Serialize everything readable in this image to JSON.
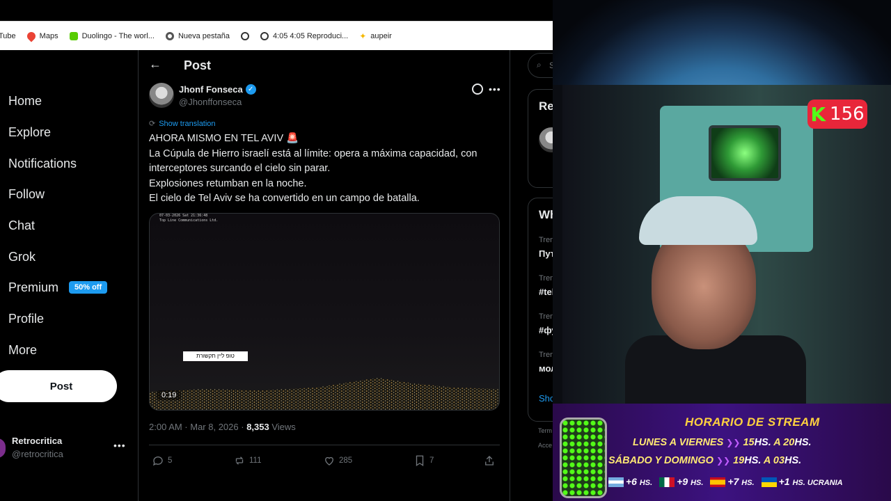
{
  "bookmarks": [
    {
      "label": "Tube",
      "icon": "youtube-icon",
      "color": "#ff0000"
    },
    {
      "label": "Maps",
      "icon": "maps-pin-icon",
      "color": "#34a853"
    },
    {
      "label": "Duolingo - The worl...",
      "icon": "duolingo-icon",
      "color": "#58cc02"
    },
    {
      "label": "Nueva pestaña",
      "icon": "chrome-icon",
      "color": "#555555"
    },
    {
      "label": "",
      "icon": "globe-icon",
      "color": "#333333"
    },
    {
      "label": "4:05 4:05 Reproduci...",
      "icon": "globe-icon",
      "color": "#333333"
    },
    {
      "label": "aupeir",
      "icon": "sparkle-icon",
      "color": "#f5b800"
    }
  ],
  "nav": {
    "items": [
      "Home",
      "Explore",
      "Notifications",
      "Follow",
      "Chat",
      "Grok",
      "Premium",
      "Profile",
      "More"
    ],
    "premium_badge": "50% off",
    "post_button": "Post",
    "account": {
      "name": "Retrocritica",
      "handle": "@retrocritica"
    }
  },
  "header": {
    "title": "Post"
  },
  "post": {
    "author": "Jhonf Fonseca",
    "handle": "@Jhonffonseca",
    "show_translation": "Show translation",
    "lines": [
      "AHORA MISMO EN TEL AVIV 🚨",
      "La Cúpula de Hierro israelí está al límite: opera a máxima capacidad, con",
      "interceptores surcando el cielo sin parar.",
      "Explosiones retumban en la noche.",
      "El cielo de Tel Aviv se ha convertido en un campo de batalla."
    ],
    "video": {
      "timestamp": "07-03-2026 Sat 21:36:48",
      "channel": "Top Line Communications Ltd.",
      "caption": "טופ ליין תקשורת",
      "duration": "0:19"
    },
    "time": "2:00 AM · Mar 8, 2026 · ",
    "views_count": "8,353",
    "views_label": " Views",
    "replies": "5",
    "reposts": "111",
    "likes": "285",
    "bookmarks": "7"
  },
  "right": {
    "search_glyph": "S",
    "relevant": "Rele",
    "whats": "Wha",
    "trending_label": "Trendi",
    "trends": [
      "Пути",
      "#telc",
      "#фут",
      "моло"
    ],
    "show": "Show",
    "terms": "Term",
    "access": "Acce"
  },
  "stream": {
    "sub_count": "156",
    "schedule_title": "HORARIO DE STREAM",
    "row1_days": "LUNES A VIERNES",
    "row1_from": "15",
    "row1_to": "20",
    "row2_days": "SÁBADO Y DOMINGO",
    "row2_from": "19",
    "row2_to": "03",
    "hs": "HS.",
    "a": "A",
    "zones": [
      {
        "offset": "+6",
        "hs": "HS.",
        "flag": "argentina"
      },
      {
        "offset": "+9",
        "hs": "HS.",
        "flag": "mexico"
      },
      {
        "offset": "+7",
        "hs": "HS.",
        "flag": "spain"
      },
      {
        "offset": "+1",
        "hs": "HS. UCRANIA",
        "flag": "ukraine"
      }
    ],
    "colors": {
      "kick_green": "#53fc18",
      "badge_red": "#e8263a",
      "schedule_yellow": "#ffd23f"
    }
  }
}
